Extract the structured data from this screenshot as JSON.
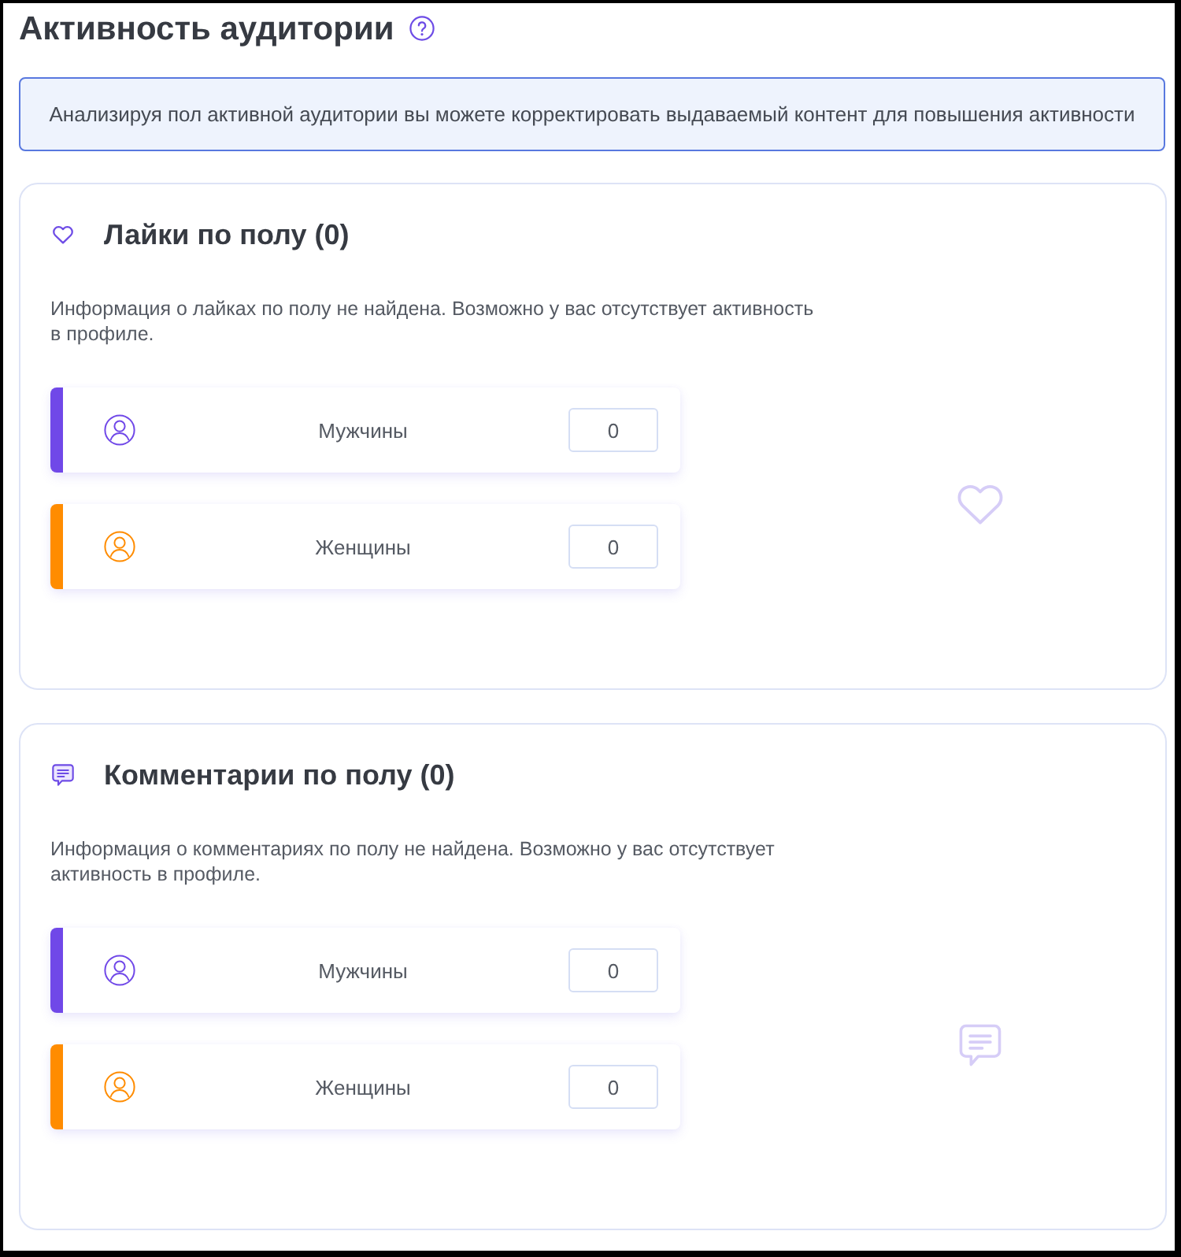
{
  "header": {
    "title": "Активность аудитории"
  },
  "banner": {
    "text": "Анализируя пол активной аудитории вы можете корректировать выдаваемый контент для повышения активности"
  },
  "sections": [
    {
      "kind": "likes",
      "title": "Лайки по полу (0)",
      "description": "Информация о лайках по полу не найдена. Возможно у вас отсутствует активность в профиле.",
      "genders": [
        {
          "label": "Мужчины",
          "value": "0",
          "color": "#7048e8"
        },
        {
          "label": "Женщины",
          "value": "0",
          "color": "#ff8c00"
        }
      ]
    },
    {
      "kind": "comments",
      "title": "Комментарии по полу (0)",
      "description": "Информация о комментариях по полу не найдена. Возможно у вас отсутствует активность в профиле.",
      "genders": [
        {
          "label": "Мужчины",
          "value": "0",
          "color": "#7048e8"
        },
        {
          "label": "Женщины",
          "value": "0",
          "color": "#ff8c00"
        }
      ]
    }
  ]
}
